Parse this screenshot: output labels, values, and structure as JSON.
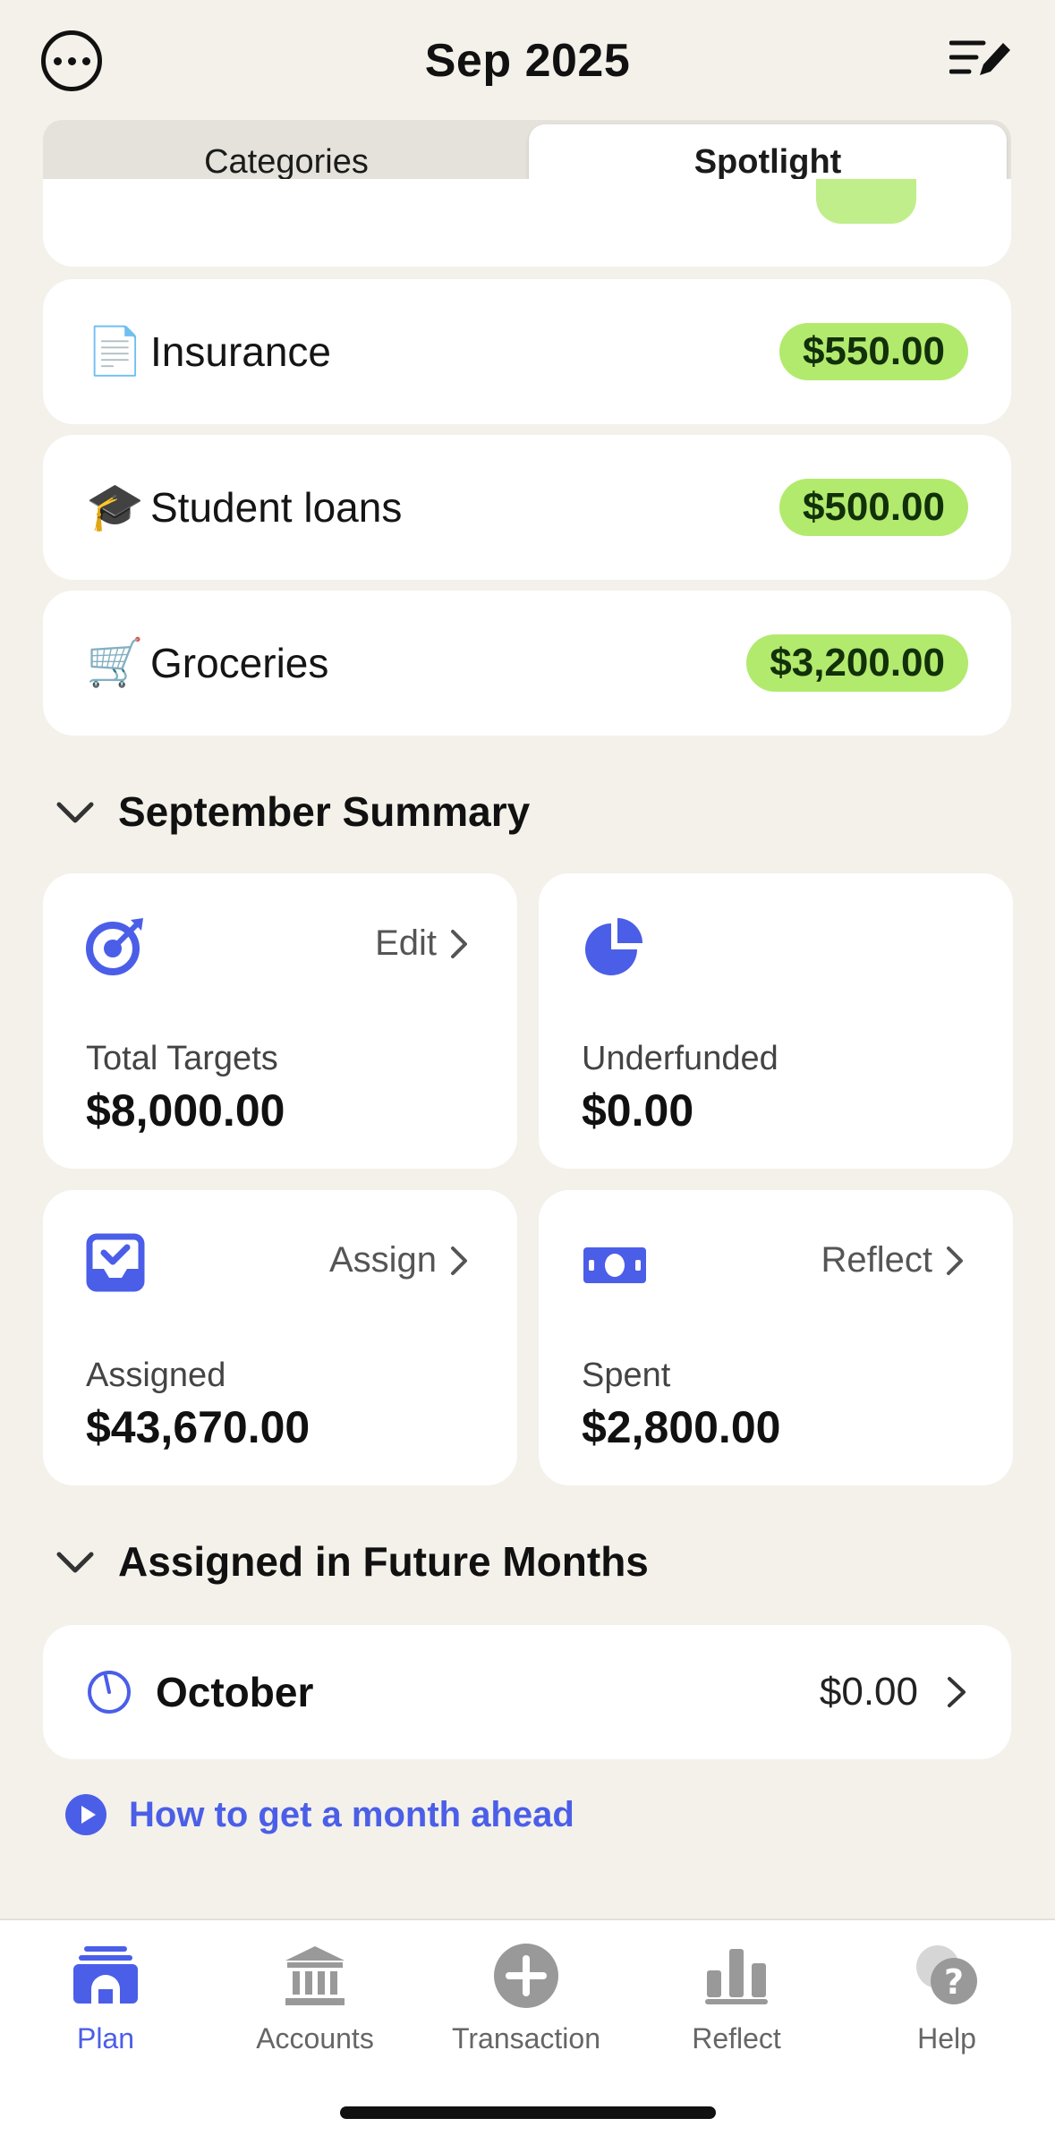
{
  "header": {
    "title": "Sep 2025",
    "more_icon": "ellipsis-circle-icon",
    "edit_icon": "list-edit-icon"
  },
  "segmented": {
    "left_label": "Categories",
    "right_label": "Spotlight",
    "selected": "Spotlight"
  },
  "categories": [
    {
      "emoji": "📄",
      "name": "Insurance",
      "amount": "$550.00"
    },
    {
      "emoji": "🎓",
      "name": "Student loans",
      "amount": "$500.00"
    },
    {
      "emoji": "🛒",
      "name": "Groceries",
      "amount": "$3,200.00"
    }
  ],
  "summary": {
    "title": "September Summary",
    "tiles": [
      {
        "icon": "target-icon",
        "link": "Edit",
        "label": "Total Targets",
        "value": "$8,000.00"
      },
      {
        "icon": "pie-chart-icon",
        "link": "",
        "label": "Underfunded",
        "value": "$0.00"
      },
      {
        "icon": "inbox-check-icon",
        "link": "Assign",
        "label": "Assigned",
        "value": "$43,670.00"
      },
      {
        "icon": "banknote-icon",
        "link": "Reflect",
        "label": "Spent",
        "value": "$2,800.00"
      }
    ]
  },
  "future": {
    "title": "Assigned in Future Months",
    "month": "October",
    "amount": "$0.00",
    "link_text": "How to get a month ahead"
  },
  "tabbar": {
    "items": [
      {
        "label": "Plan",
        "icon": "plan-icon",
        "active": true
      },
      {
        "label": "Accounts",
        "icon": "bank-icon",
        "active": false
      },
      {
        "label": "Transaction",
        "icon": "plus-circle-icon",
        "active": false
      },
      {
        "label": "Reflect",
        "icon": "bar-chart-icon",
        "active": false
      },
      {
        "label": "Help",
        "icon": "help-bubble-icon",
        "active": false
      }
    ]
  },
  "colors": {
    "accent": "#4b5ee8",
    "pill_green": "#b2ea6d",
    "background": "#f3f1ea"
  }
}
